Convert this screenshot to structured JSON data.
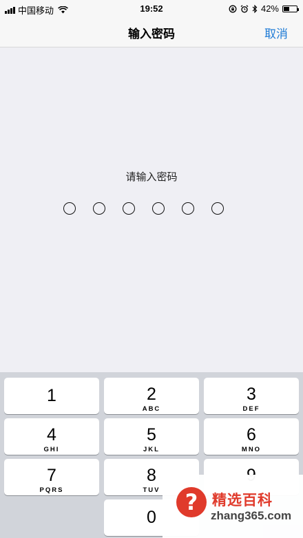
{
  "status_bar": {
    "carrier": "中国移动",
    "time": "19:52",
    "battery_percent": "42%",
    "battery_level": 0.42
  },
  "nav": {
    "title": "输入密码",
    "cancel_label": "取消"
  },
  "prompt": "请输入密码",
  "passcode_length": 6,
  "keypad": {
    "k1": {
      "digit": "1"
    },
    "k2": {
      "digit": "2",
      "letters": "ABC"
    },
    "k3": {
      "digit": "3",
      "letters": "DEF"
    },
    "k4": {
      "digit": "4",
      "letters": "GHI"
    },
    "k5": {
      "digit": "5",
      "letters": "JKL"
    },
    "k6": {
      "digit": "6",
      "letters": "MNO"
    },
    "k7": {
      "digit": "7",
      "letters": "PQRS"
    },
    "k8": {
      "digit": "8",
      "letters": "TUV"
    },
    "k9": {
      "digit": "9"
    },
    "k0": {
      "digit": "0"
    }
  },
  "watermark": {
    "badge": "?",
    "title": "精选百科",
    "url": "zhang365.com"
  },
  "colors": {
    "accent": "#1e7bd6",
    "watermark": "#e03a2b"
  }
}
